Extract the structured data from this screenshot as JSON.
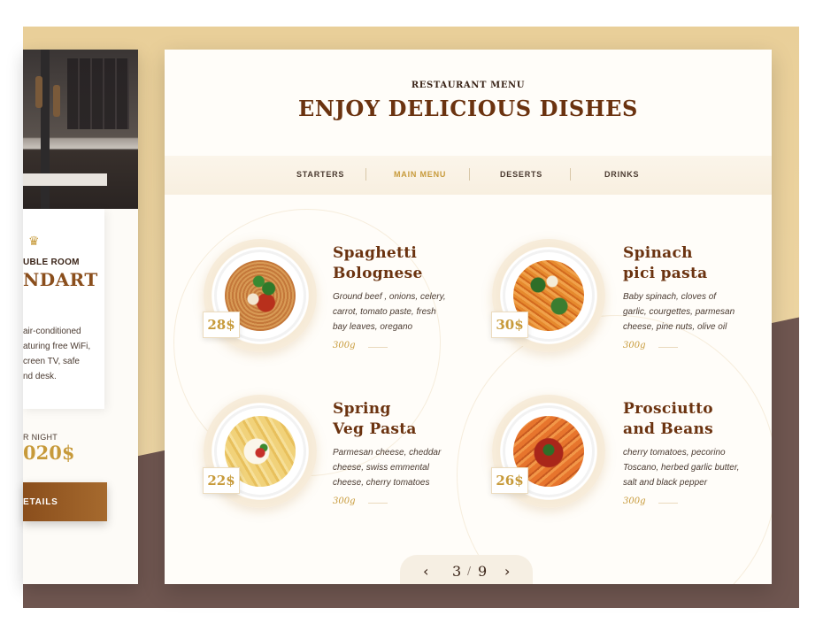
{
  "left_panel": {
    "crown_icon": "crown-icon",
    "room_type": "UBLE ROOM",
    "room_name": "NDART",
    "description": [
      "air-conditioned",
      "aturing free WiFi,",
      "creen TV, safe",
      "nd desk."
    ],
    "per_night_label": "R NIGHT",
    "price": "020$",
    "details_label": "ETAILS"
  },
  "menu": {
    "eyebrow": "RESTAURANT MENU",
    "headline": "ENJOY DELICIOUS DISHES",
    "tabs": [
      {
        "label": "STARTERS",
        "active": false
      },
      {
        "label": "MAIN MENU",
        "active": true
      },
      {
        "label": "DESERTS",
        "active": false
      },
      {
        "label": "DRINKS",
        "active": false
      }
    ],
    "dishes": [
      {
        "title_line1": "Spaghetti",
        "title_line2": "Bolognese",
        "desc_line1": "Ground beef , onions, celery,",
        "desc_line2": "carrot, tomato paste, fresh",
        "desc_line3": "bay leaves, oregano",
        "weight": "300g",
        "price": "28$"
      },
      {
        "title_line1": "Spinach",
        "title_line2": "pici pasta",
        "desc_line1": "Baby spinach, cloves of",
        "desc_line2": "garlic, courgettes, parmesan",
        "desc_line3": "cheese, pine nuts, olive oil",
        "weight": "300g",
        "price": "30$"
      },
      {
        "title_line1": "Spring",
        "title_line2": "Veg Pasta",
        "desc_line1": "Parmesan cheese, cheddar",
        "desc_line2": "cheese, swiss emmental",
        "desc_line3": "cheese, cherry tomatoes",
        "weight": "300g",
        "price": "22$"
      },
      {
        "title_line1": "Prosciutto",
        "title_line2": "and Beans",
        "desc_line1": "cherry tomatoes, pecorino",
        "desc_line2": "Toscano, herbed garlic butter,",
        "desc_line3": "salt and black pepper",
        "weight": "300g",
        "price": "26$"
      }
    ],
    "pager": {
      "prev_icon": "chevron-left-icon",
      "next_icon": "chevron-right-icon",
      "prev_glyph": "‹",
      "next_glyph": "›",
      "current": "3",
      "separator": "/",
      "total": "9"
    }
  },
  "colors": {
    "brown_title": "#6b3310",
    "gold_accent": "#c79a3a",
    "beige_bg": "#efd8a8",
    "dark_band": "#6f5650"
  }
}
